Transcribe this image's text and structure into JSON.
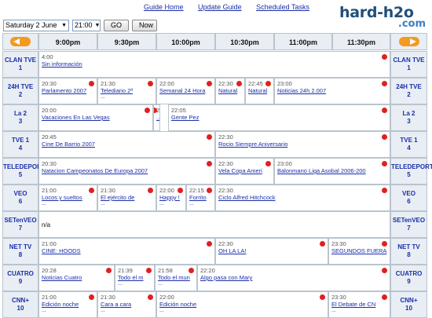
{
  "nav": {
    "links": [
      "Guide Home",
      "Update Guide",
      "Scheduled Tasks"
    ]
  },
  "logo": {
    "line1": "hard-h2o",
    "line2": ".com"
  },
  "controls": {
    "date": "Saturday 2 June",
    "time": "21:00",
    "go": "GO",
    "now": "Now"
  },
  "times": [
    "9:00pm",
    "9:30pm",
    "10:00pm",
    "10:30pm",
    "11:00pm",
    "11:30pm"
  ],
  "channels": [
    {
      "name": "CLAN TVE",
      "num": "1",
      "progs": [
        {
          "t": "4:00",
          "n": "Sin información",
          "rec": true
        }
      ]
    },
    {
      "name": "24H TVE",
      "num": "2",
      "progs": [
        {
          "t": "20:30",
          "n": "Parlamento 2007",
          "rec": true
        },
        {
          "t": "21:30",
          "n": "Telediario 2ª",
          "rec": true,
          "d": "..."
        },
        {
          "t": "22:00",
          "n": "Semanal 24 Hora",
          "rec": true
        },
        {
          "t": "22:30",
          "n": "Natural",
          "rec": true
        },
        {
          "t": "22:45",
          "n": "Natural",
          "rec": true
        },
        {
          "t": "23:00",
          "n": "Noticias 24h 2.007",
          "rec": true
        }
      ]
    },
    {
      "name": "La 2",
      "num": "3",
      "progs": [
        {
          "t": "20:00",
          "n": "Vacaciones En Las Vegas",
          "rec": true
        },
        {
          "t": "2",
          "n": "...",
          "rec": true
        },
        {
          "t": "22:05",
          "n": "Gente Pez",
          "rec": true
        }
      ]
    },
    {
      "name": "TVE 1",
      "num": "4",
      "progs": [
        {
          "t": "20:45",
          "n": "Cine De Barrio 2007",
          "rec": true
        },
        {
          "t": "22:30",
          "n": "Rocio Siempre Aniversario",
          "rec": true
        }
      ]
    },
    {
      "name": "TELEDEPORTE",
      "num": "5",
      "progs": [
        {
          "t": "20:30",
          "n": "Natacion Campeonatos De Europa 2007",
          "rec": true
        },
        {
          "t": "22:30",
          "n": "Vela Copa Ameri",
          "rec": true
        },
        {
          "t": "23:00",
          "n": "Balonmano Liga Asobal 2006-200",
          "rec": true
        }
      ]
    },
    {
      "name": "VEO",
      "num": "6",
      "progs": [
        {
          "t": "21:00",
          "n": "Locos y sueltos",
          "rec": true,
          "d": "..."
        },
        {
          "t": "21:30",
          "n": "El ejército de",
          "rec": true,
          "d": "..."
        },
        {
          "t": "22:00",
          "n": "Happy !",
          "rec": true,
          "d": "..."
        },
        {
          "t": "22:15",
          "n": "Forrito",
          "rec": true,
          "d": "..."
        },
        {
          "t": "22:30",
          "n": "Ciclo Alfred Hitchcock",
          "rec": true
        }
      ]
    },
    {
      "name": "SETenVEO",
      "num": "7",
      "progs": [
        {
          "plain": "n/a"
        }
      ]
    },
    {
      "name": "NET TV",
      "num": "8",
      "progs": [
        {
          "t": "21:00",
          "n": "CINE: HOODS",
          "rec": true
        },
        {
          "t": "22:30",
          "n": "OH LA LA!",
          "rec": true
        },
        {
          "t": "23:30",
          "n": "SEGUNDOS FUERA",
          "rec": true
        }
      ]
    },
    {
      "name": "CUATRO",
      "num": "9",
      "progs": [
        {
          "t": "20:28",
          "n": "Noticias Cuatro",
          "rec": true
        },
        {
          "t": "21:39",
          "n": "Todo el m",
          "rec": true,
          "d": "..."
        },
        {
          "t": "21:58",
          "n": "Todo el mun",
          "rec": true,
          "d": "..."
        },
        {
          "t": "22:20",
          "n": "Algo pasa con Mary",
          "rec": true
        }
      ]
    },
    {
      "name": "CNN+",
      "num": "10",
      "progs": [
        {
          "t": "21:00",
          "n": "Edición noche",
          "rec": true,
          "d": "..."
        },
        {
          "t": "21:30",
          "n": "Cara a cara",
          "rec": true,
          "d": "..."
        },
        {
          "t": "22:00",
          "n": "Edición noche",
          "rec": true,
          "d": "..."
        },
        {
          "t": "23:30",
          "n": "El Debate de CN",
          "rec": true,
          "d": "..."
        }
      ]
    }
  ],
  "colors": {
    "link": "#1a2fa8",
    "rec": "#e02020",
    "arrow": "#f39a1f",
    "cellbg": "#e8eef4"
  }
}
